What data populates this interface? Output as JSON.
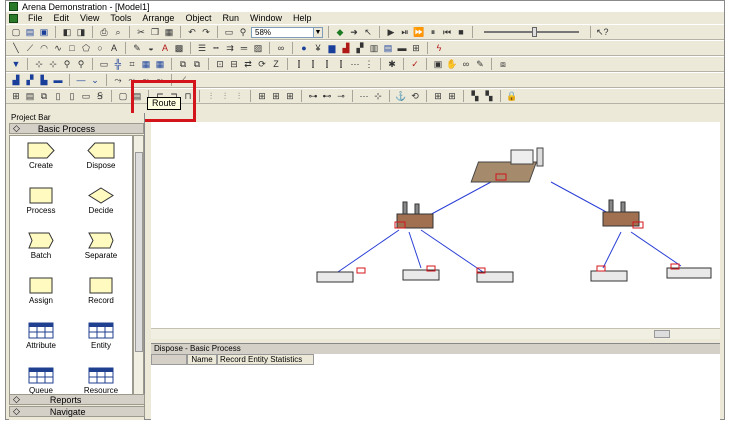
{
  "window": {
    "title": "Arena Demonstration - [Model1]"
  },
  "menu": [
    "File",
    "Edit",
    "View",
    "Tools",
    "Arrange",
    "Object",
    "Run",
    "Window",
    "Help"
  ],
  "toolbar": {
    "zoom_value": "58%"
  },
  "tooltip": {
    "text": "Route"
  },
  "project_bar": {
    "title": "Project Bar",
    "panel_header": "Basic Process",
    "modules": [
      {
        "label": "Create",
        "icon": "create-module-icon"
      },
      {
        "label": "Dispose",
        "icon": "dispose-module-icon"
      },
      {
        "label": "Process",
        "icon": "process-module-icon"
      },
      {
        "label": "Decide",
        "icon": "decide-module-icon"
      },
      {
        "label": "Batch",
        "icon": "batch-module-icon"
      },
      {
        "label": "Separate",
        "icon": "separate-module-icon"
      },
      {
        "label": "Assign",
        "icon": "assign-module-icon"
      },
      {
        "label": "Record",
        "icon": "record-module-icon"
      },
      {
        "label": "Attribute",
        "icon": "attribute-module-icon"
      },
      {
        "label": "Entity",
        "icon": "entity-module-icon"
      },
      {
        "label": "Queue",
        "icon": "queue-module-icon"
      },
      {
        "label": "Resource",
        "icon": "resource-module-icon"
      }
    ],
    "reports_label": "Reports",
    "navigate_label": "Navigate"
  },
  "spreadsheet": {
    "title": "Dispose - Basic Process",
    "columns": [
      "Name",
      "Record Entity Statistics"
    ]
  },
  "colors": {
    "accent_red": "#d4141b",
    "route_line": "#2b3fd6"
  }
}
